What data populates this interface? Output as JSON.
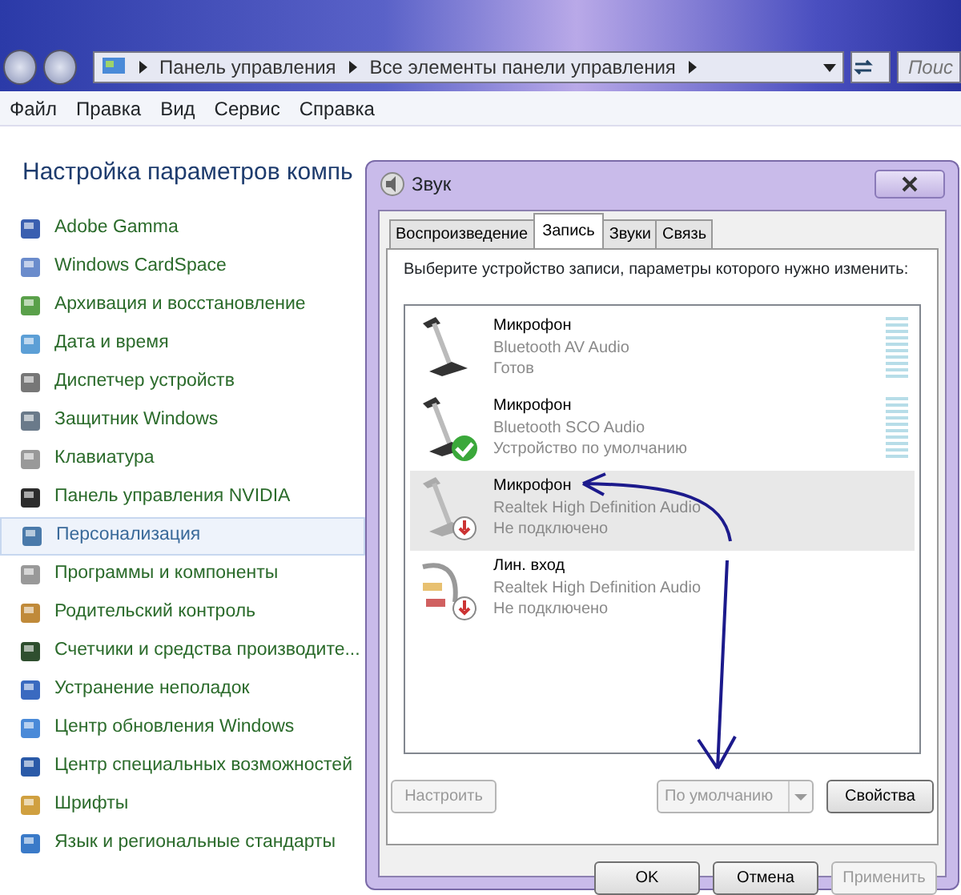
{
  "explorer": {
    "address": [
      "Панель управления",
      "Все элементы панели управления"
    ],
    "search": {
      "placeholder": "Поис"
    },
    "menu": [
      "Файл",
      "Правка",
      "Вид",
      "Сервис",
      "Справка"
    ],
    "heading": "Настройка параметров компь",
    "items": [
      {
        "label": "Adobe Gamma",
        "selected": false
      },
      {
        "label": "Windows CardSpace",
        "selected": false
      },
      {
        "label": "Архивация и восстановление",
        "selected": false
      },
      {
        "label": "Дата и время",
        "selected": false
      },
      {
        "label": "Диспетчер устройств",
        "selected": false
      },
      {
        "label": "Защитник Windows",
        "selected": false
      },
      {
        "label": "Клавиатура",
        "selected": false
      },
      {
        "label": "Панель управления NVIDIA",
        "selected": false
      },
      {
        "label": "Персонализация",
        "selected": true
      },
      {
        "label": "Программы и компоненты",
        "selected": false
      },
      {
        "label": "Родительский контроль",
        "selected": false
      },
      {
        "label": "Счетчики и средства производите...",
        "selected": false
      },
      {
        "label": "Устранение неполадок",
        "selected": false
      },
      {
        "label": "Центр обновления Windows",
        "selected": false
      },
      {
        "label": "Центр специальных возможностей",
        "selected": false
      },
      {
        "label": "Шрифты",
        "selected": false
      },
      {
        "label": "Язык и региональные стандарты",
        "selected": false
      }
    ]
  },
  "dialog": {
    "title": "Звук",
    "tabs": [
      {
        "label": "Воспроизведение",
        "selected": false
      },
      {
        "label": "Запись",
        "selected": true
      },
      {
        "label": "Звуки",
        "selected": false
      },
      {
        "label": "Связь",
        "selected": false
      }
    ],
    "prompt": "Выберите устройство записи, параметры которого нужно изменить:",
    "devices": [
      {
        "kind": "mic",
        "name": "Микрофон",
        "driver": "Bluetooth AV Audio",
        "status": "Готов",
        "is_default": false,
        "unplugged": false,
        "meter": true,
        "selected": false
      },
      {
        "kind": "mic",
        "name": "Микрофон",
        "driver": "Bluetooth SCO Audio",
        "status": "Устройство по умолчанию",
        "is_default": true,
        "unplugged": false,
        "meter": true,
        "selected": false
      },
      {
        "kind": "mic",
        "name": "Микрофон",
        "driver": "Realtek High Definition Audio",
        "status": "Не подключено",
        "is_default": false,
        "unplugged": true,
        "meter": false,
        "selected": true
      },
      {
        "kind": "line",
        "name": "Лин. вход",
        "driver": "Realtek High Definition Audio",
        "status": "Не подключено",
        "is_default": false,
        "unplugged": true,
        "meter": false,
        "selected": false
      }
    ],
    "configure": {
      "label": "Настроить",
      "disabled": true
    },
    "set_default": {
      "label": "По умолчанию",
      "disabled": true
    },
    "properties": {
      "label": "Свойства",
      "disabled": false
    },
    "ok": {
      "label": "OK",
      "disabled": false
    },
    "cancel": {
      "label": "Отмена",
      "disabled": false
    },
    "apply": {
      "label": "Применить",
      "disabled": true
    }
  }
}
